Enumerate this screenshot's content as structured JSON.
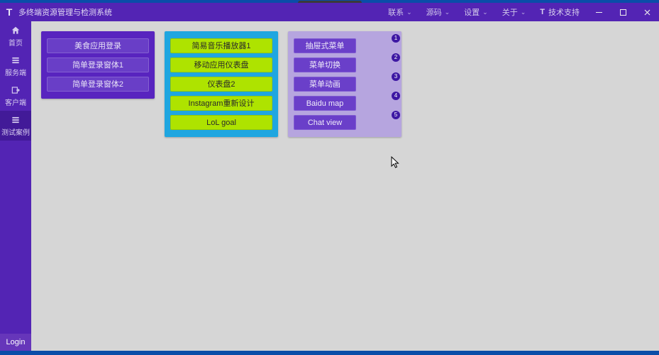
{
  "app": {
    "title": "多终端资源管理与检测系统"
  },
  "menubar": {
    "items": [
      {
        "label": "联系",
        "dropdown": true
      },
      {
        "label": "源码",
        "dropdown": true
      },
      {
        "label": "设置",
        "dropdown": true
      },
      {
        "label": "关于",
        "dropdown": true
      }
    ],
    "support": "技术支持"
  },
  "sidebar": {
    "items": [
      {
        "label": "首页",
        "icon": "home"
      },
      {
        "label": "服务端",
        "icon": "list"
      },
      {
        "label": "客户端",
        "icon": "export"
      },
      {
        "label": "测试案例",
        "icon": "list"
      }
    ],
    "active_index": 3,
    "login": "Login"
  },
  "cards": [
    {
      "style": "c1",
      "buttons": [
        {
          "label": "美食应用登录"
        },
        {
          "label": "简单登录窗体1"
        },
        {
          "label": "简单登录窗体2"
        }
      ]
    },
    {
      "style": "c2",
      "buttons": [
        {
          "label": "简易音乐播放器1"
        },
        {
          "label": "移动应用仪表盘"
        },
        {
          "label": "仪表盘2"
        },
        {
          "label": "Instagram重新设计"
        },
        {
          "label": "LoL goal"
        }
      ]
    },
    {
      "style": "c3",
      "buttons": [
        {
          "label": "抽屉式菜单",
          "badge": "1"
        },
        {
          "label": "菜单切换",
          "badge": "2"
        },
        {
          "label": "菜单动画",
          "badge": "3"
        },
        {
          "label": "Baidu map",
          "badge": "4"
        },
        {
          "label": "Chat view",
          "badge": "5"
        }
      ]
    }
  ]
}
